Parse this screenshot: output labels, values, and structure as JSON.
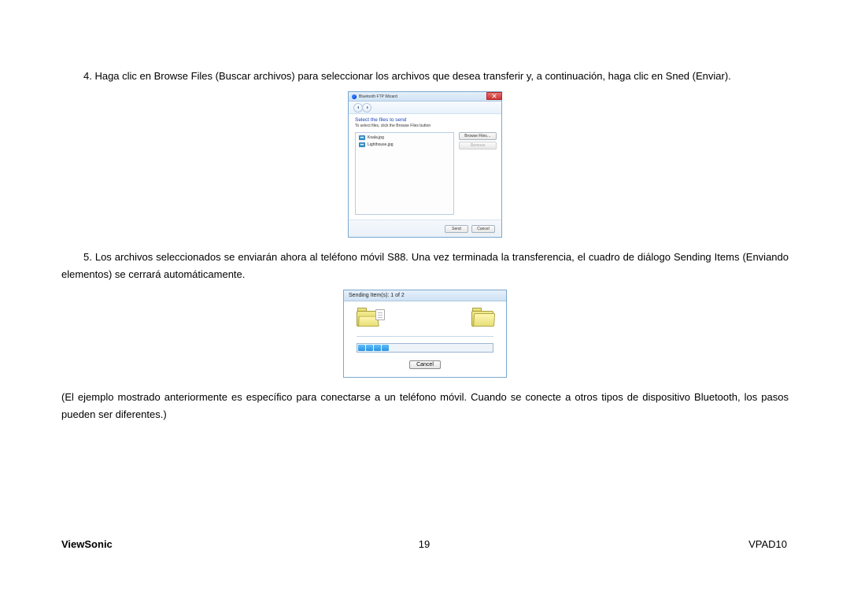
{
  "paragraph4": "4. Haga clic en Browse Files (Buscar archivos) para seleccionar los archivos que desea transferir y, a continuación, haga clic en Sned (Enviar).",
  "paragraph5": "5. Los archivos seleccionados se enviarán ahora al teléfono móvil S88. Una vez terminada la transferencia, el cuadro de diálogo Sending Items (Enviando elementos) se cerrará automáticamente.",
  "note": "(El ejemplo mostrado anteriormente es específico para conectarse a un teléfono móvil. Cuando se conecte a otros tipos de dispositivo Bluetooth, los pasos pueden ser diferentes.)",
  "wizard": {
    "title": "Bluetooth FTP Wizard",
    "heading": "Select the files to send",
    "sub": "To select files, click the Browse Files button",
    "files": [
      "Koala.jpg",
      "Lighthouse.jpg"
    ],
    "browse_btn": "Browse Files…",
    "remove_btn": "Remove",
    "send_btn": "Send",
    "cancel_btn": "Cancel"
  },
  "sending": {
    "title": "Sending Item(s): 1 of 2",
    "cancel_btn": "Cancel"
  },
  "footer": {
    "brand": "ViewSonic",
    "page": "19",
    "model": "VPAD10"
  }
}
